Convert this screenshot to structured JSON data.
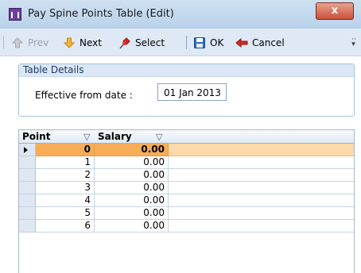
{
  "window": {
    "title": "Pay Spine Points Table (Edit)",
    "close_label": "x",
    "title_icon": "table-icon"
  },
  "toolbar": {
    "prev_label": "Prev",
    "next_label": "Next",
    "select_label": "Select",
    "ok_label": "OK",
    "cancel_label": "Cancel",
    "icons": [
      "arrow-up-icon",
      "arrow-down-icon",
      "pin-icon",
      "save-icon",
      "back-arrow-icon"
    ]
  },
  "details": {
    "group_title": "Table Details",
    "effective_label": "Effective from date :",
    "effective_value": "01 Jan 2013"
  },
  "grid": {
    "columns": [
      "Point",
      "Salary"
    ],
    "rows": [
      {
        "point": "0",
        "salary": "0.00"
      },
      {
        "point": "1",
        "salary": "0.00"
      },
      {
        "point": "2",
        "salary": "0.00"
      },
      {
        "point": "3",
        "salary": "0.00"
      },
      {
        "point": "4",
        "salary": "0.00"
      },
      {
        "point": "5",
        "salary": "0.00"
      },
      {
        "point": "6",
        "salary": "0.00"
      }
    ],
    "selected_row": 0,
    "highlight_color": "#f7ad57"
  }
}
